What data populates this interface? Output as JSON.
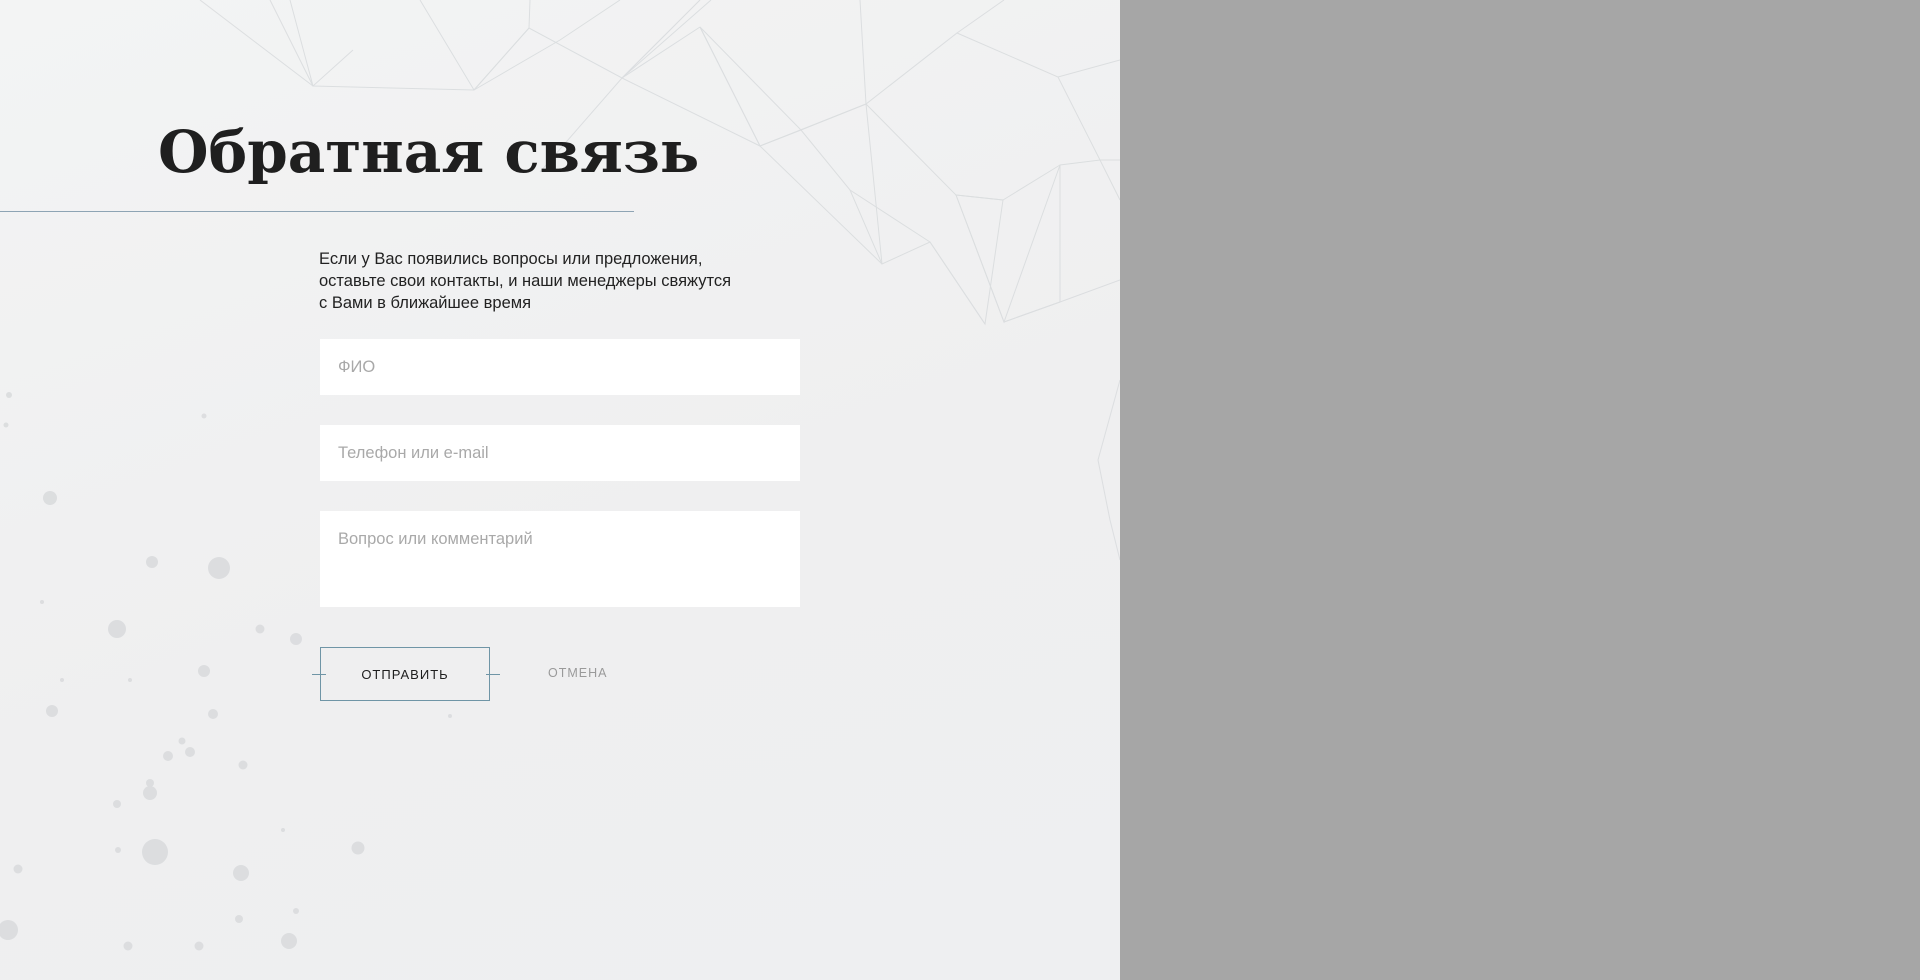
{
  "feedback": {
    "title": "Обратная связь",
    "intro_lines": [
      "Если у Вас появились вопросы или предложения,",
      "оставьте свои контакты, и наши менеджеры свяжутся",
      "с Вами в ближайшее время"
    ],
    "fields": {
      "name": {
        "placeholder": "ФИО",
        "value": ""
      },
      "contact": {
        "placeholder": "Телефон или e-mail",
        "value": ""
      },
      "comment": {
        "placeholder": "Вопрос или комментарий",
        "value": ""
      }
    },
    "buttons": {
      "submit_label": "ОТПРАВИТЬ",
      "cancel_label": "ОТМЕНА"
    }
  },
  "colors": {
    "panel_background": "#f1f2f2",
    "overlay": "#a6a6a6",
    "accent_line": "#6f95a6",
    "title_text": "#1f1f1f"
  }
}
